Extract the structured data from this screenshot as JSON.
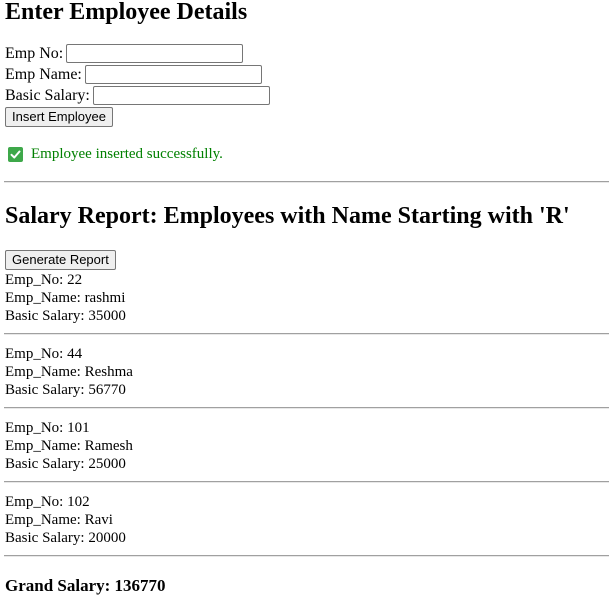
{
  "form": {
    "title": "Enter Employee Details",
    "fields": [
      {
        "label": "Emp No:",
        "value": ""
      },
      {
        "label": "Emp Name:",
        "value": ""
      },
      {
        "label": "Basic Salary:",
        "value": ""
      }
    ],
    "insert_button": "Insert Employee",
    "success_message": "Employee inserted successfully.",
    "success_icon": "check-box-icon",
    "success_color": "#008000"
  },
  "report": {
    "title": "Salary Report: Employees with Name Starting with 'R'",
    "generate_button": "Generate Report",
    "employees": [
      {
        "no_label": "Emp_No: 22",
        "name_label": "Emp_Name: rashmi",
        "salary_label": "Basic Salary: 35000"
      },
      {
        "no_label": "Emp_No: 44",
        "name_label": "Emp_Name: Reshma",
        "salary_label": "Basic Salary: 56770"
      },
      {
        "no_label": "Emp_No: 101",
        "name_label": "Emp_Name: Ramesh",
        "salary_label": "Basic Salary: 25000"
      },
      {
        "no_label": "Emp_No: 102",
        "name_label": "Emp_Name: Ravi",
        "salary_label": "Basic Salary: 20000"
      }
    ],
    "grand_total": "Grand Salary: 136770"
  }
}
